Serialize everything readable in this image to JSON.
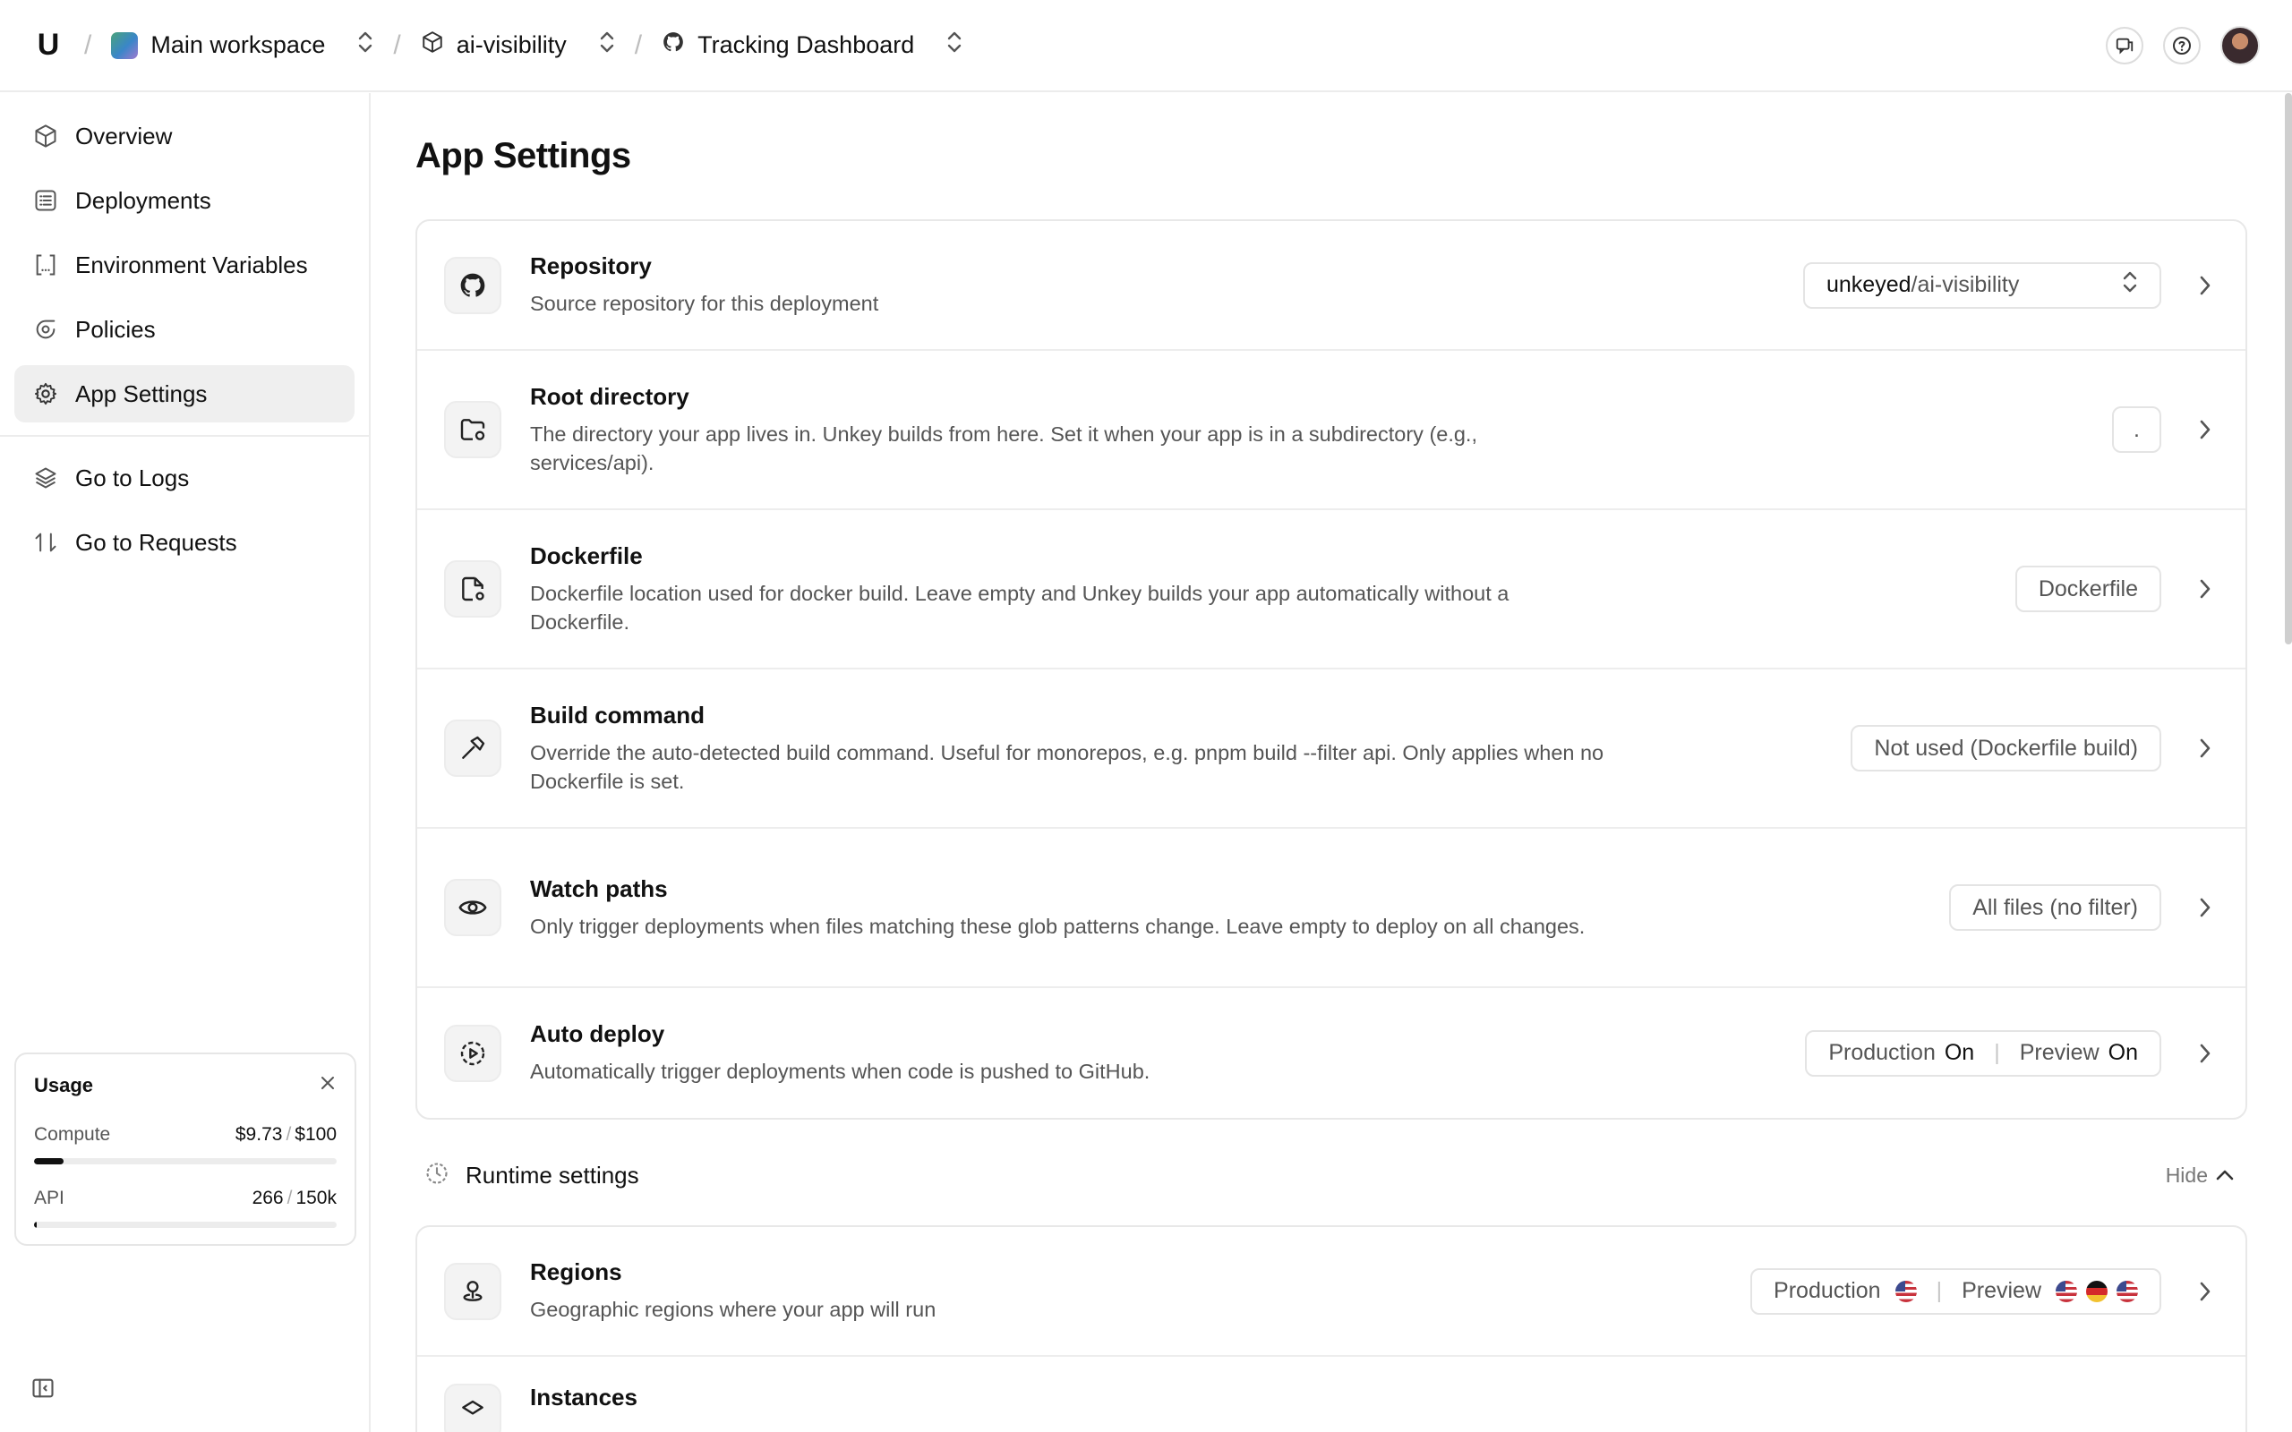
{
  "topbar": {
    "logo": "U",
    "workspace": "Main workspace",
    "project": "ai-visibility",
    "app": "Tracking Dashboard",
    "icons": [
      "feedback-icon",
      "help-icon",
      "avatar"
    ]
  },
  "sidebar": {
    "items": [
      {
        "label": "Overview",
        "icon": "cube-icon"
      },
      {
        "label": "Deployments",
        "icon": "list-icon"
      },
      {
        "label": "Environment Variables",
        "icon": "brackets-icon"
      },
      {
        "label": "Policies",
        "icon": "shield-icon"
      },
      {
        "label": "App Settings",
        "icon": "gear-icon",
        "active": true
      }
    ],
    "secondary": [
      {
        "label": "Go to Logs",
        "icon": "layers-icon"
      },
      {
        "label": "Go to Requests",
        "icon": "arrows-icon"
      }
    ],
    "usage": {
      "title": "Usage",
      "compute_label": "Compute",
      "compute_used": "$9.73",
      "compute_limit": "$100",
      "compute_fraction": 0.0973,
      "api_label": "API",
      "api_used": "266",
      "api_limit": "150k",
      "api_fraction": 0.0018
    }
  },
  "main": {
    "title": "App Settings",
    "settings": [
      {
        "title": "Repository",
        "desc": "Source repository for this deployment",
        "owner": "unkeyed",
        "repo": "/ai-visibility"
      },
      {
        "title": "Root directory",
        "desc": "The directory your app lives in. Unkey builds from here. Set it when your app is in a subdirectory (e.g., services/api).",
        "value": "."
      },
      {
        "title": "Dockerfile",
        "desc": "Dockerfile location used for docker build. Leave empty and Unkey builds your app automatically without a Dockerfile.",
        "value": "Dockerfile"
      },
      {
        "title": "Build command",
        "desc": "Override the auto-detected build command. Useful for monorepos, e.g. pnpm build --filter api. Only applies when no Dockerfile is set.",
        "value": "Not used (Dockerfile build)"
      },
      {
        "title": "Watch paths",
        "desc": "Only trigger deployments when files matching these glob patterns change. Leave empty to deploy on all changes.",
        "value": "All files (no filter)"
      },
      {
        "title": "Auto deploy",
        "desc": "Automatically trigger deployments when code is pushed to GitHub.",
        "prod_label": "Production",
        "prod_value": "On",
        "preview_label": "Preview",
        "preview_value": "On"
      }
    ],
    "runtime": {
      "title": "Runtime settings",
      "toggle": "Hide",
      "regions": {
        "title": "Regions",
        "desc": "Geographic regions where your app will run",
        "prod_label": "Production",
        "preview_label": "Preview"
      },
      "instances": {
        "title": "Instances"
      }
    }
  }
}
